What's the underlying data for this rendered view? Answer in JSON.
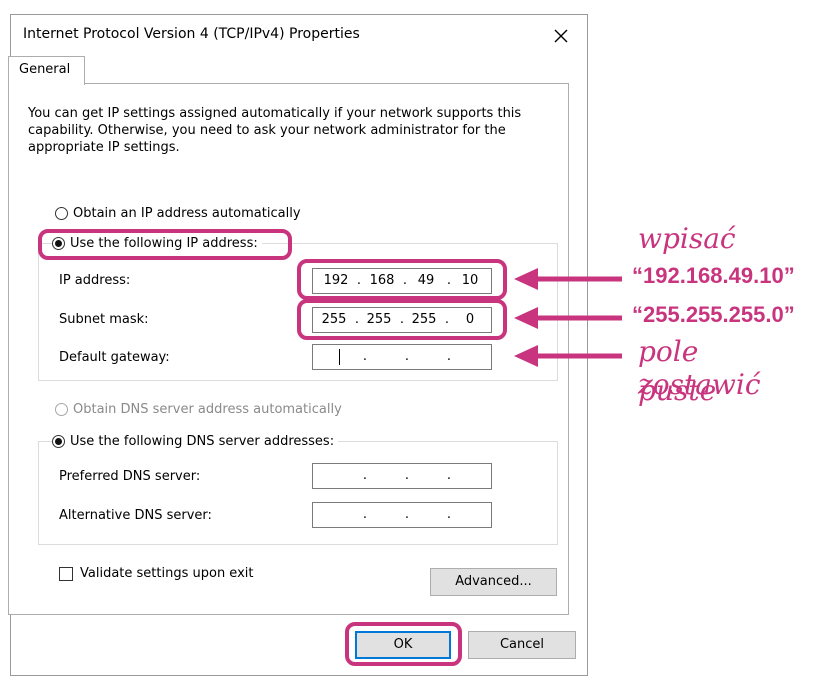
{
  "window": {
    "title": "Internet Protocol Version 4 (TCP/IPv4) Properties",
    "close_icon": "close-icon"
  },
  "tabs": [
    {
      "label": "General",
      "active": true
    }
  ],
  "description": "You can get IP settings assigned automatically if your network supports this capability. Otherwise, you need to ask your network administrator for the appropriate IP settings.",
  "ip_section": {
    "obtain_auto_label": "Obtain an IP address automatically",
    "obtain_auto_checked": false,
    "use_following_label": "Use the following IP address:",
    "use_following_checked": true,
    "ip_address": {
      "label": "IP address:",
      "octets": [
        "192",
        "168",
        "49",
        "10"
      ]
    },
    "subnet_mask": {
      "label": "Subnet mask:",
      "octets": [
        "255",
        "255",
        "255",
        "0"
      ]
    },
    "default_gateway": {
      "label": "Default gateway:",
      "octets": [
        "",
        "",
        "",
        ""
      ]
    }
  },
  "dns_section": {
    "obtain_auto_label": "Obtain DNS server address automatically",
    "obtain_auto_checked": false,
    "obtain_auto_disabled": true,
    "use_following_label": "Use the following DNS server addresses:",
    "use_following_checked": true,
    "preferred": {
      "label": "Preferred DNS server:",
      "octets": [
        "",
        "",
        "",
        ""
      ]
    },
    "alternative": {
      "label": "Alternative DNS server:",
      "octets": [
        "",
        "",
        "",
        ""
      ]
    }
  },
  "validate": {
    "label": "Validate settings upon exit",
    "checked": false
  },
  "buttons": {
    "advanced": "Advanced...",
    "ok": "OK",
    "cancel": "Cancel"
  },
  "annotations": {
    "line1": "wpisać",
    "ip_value": "“192.168.49.10”",
    "mask_value": "“255.255.255.0”",
    "line2": "pole zostawić",
    "line3": "puste",
    "color": "#c8357e"
  }
}
